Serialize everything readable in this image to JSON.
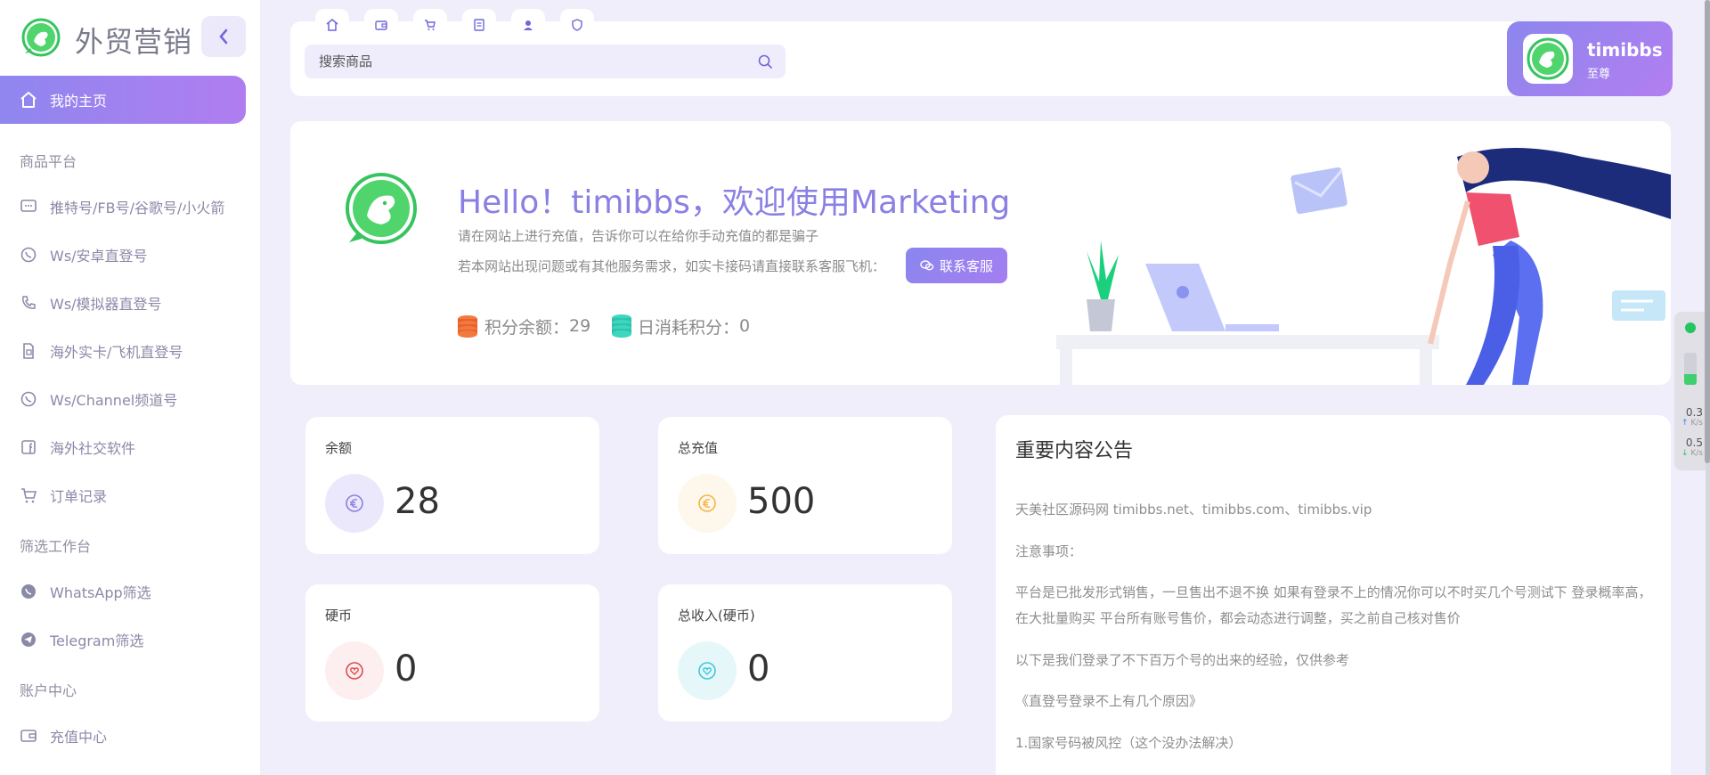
{
  "brand": {
    "name": "外贸营销"
  },
  "sidebar": {
    "home": "我的主页",
    "sections": [
      {
        "title": "商品平台",
        "items": [
          "推特号/FB号/谷歌号/小火箭",
          "Ws/安卓直登号",
          "Ws/模拟器直登号",
          "海外实卡/飞机直登号",
          "Ws/Channel频道号",
          "海外社交软件",
          "订单记录"
        ]
      },
      {
        "title": "筛选工作台",
        "items": [
          "WhatsApp筛选",
          "Telegram筛选"
        ]
      },
      {
        "title": "账户中心",
        "items": [
          "充值中心"
        ]
      }
    ]
  },
  "header": {
    "tab_icons": [
      "home-icon",
      "wallet-icon",
      "cart-icon",
      "document-icon",
      "user-icon",
      "shield-icon"
    ],
    "search_placeholder": "搜索商品",
    "user": {
      "name": "timibbs",
      "level": "至尊"
    }
  },
  "banner": {
    "title": "Hello！timibbs，欢迎使用Marketing",
    "line1": "请在网站上进行充值，告诉你可以在给你手动充值的都是骗子",
    "line2": "若本网站出现问题或有其他服务需求，如实卡接码请直接联系客服飞机：",
    "contact_button": "联系客服",
    "points_balance_label": "积分余额：",
    "points_balance_value": "29",
    "daily_points_label": "日消耗积分：",
    "daily_points_value": "0"
  },
  "stats": [
    {
      "label": "余额",
      "value": "28",
      "icon": "euro-icon",
      "color": "#8a80e4",
      "bg": "#ece8fb"
    },
    {
      "label": "总充值",
      "value": "500",
      "icon": "euro-icon",
      "color": "#f5b545",
      "bg": "#fef8ec"
    },
    {
      "label": "硬币",
      "value": "0",
      "icon": "heart-icon",
      "color": "#e04a4a",
      "bg": "#fdeff0"
    },
    {
      "label": "总收入(硬币)",
      "value": "0",
      "icon": "heart-icon",
      "color": "#3fc7d9",
      "bg": "#e6f7fa"
    }
  ],
  "notice": {
    "title": "重要内容公告",
    "paragraphs": [
      "天美社区源码网 timibbs.net、timibbs.com、timibbs.vip",
      "注意事项：",
      "平台是已批发形式销售，一旦售出不退不换 如果有登录不上的情况你可以不时买几个号测试下 登录概率高，在大批量购买 平台所有账号售价，都会动态进行调整，买之前自己核对售价",
      "以下是我们登录了不下百万个号的出来的经验，仅供参考",
      "《直登号登录不上有几个原因》",
      "1.国家号码被风控（这个没办法解决）"
    ]
  },
  "net_speed": {
    "up": "0.3",
    "down": "0.5",
    "unit": "K/s"
  }
}
